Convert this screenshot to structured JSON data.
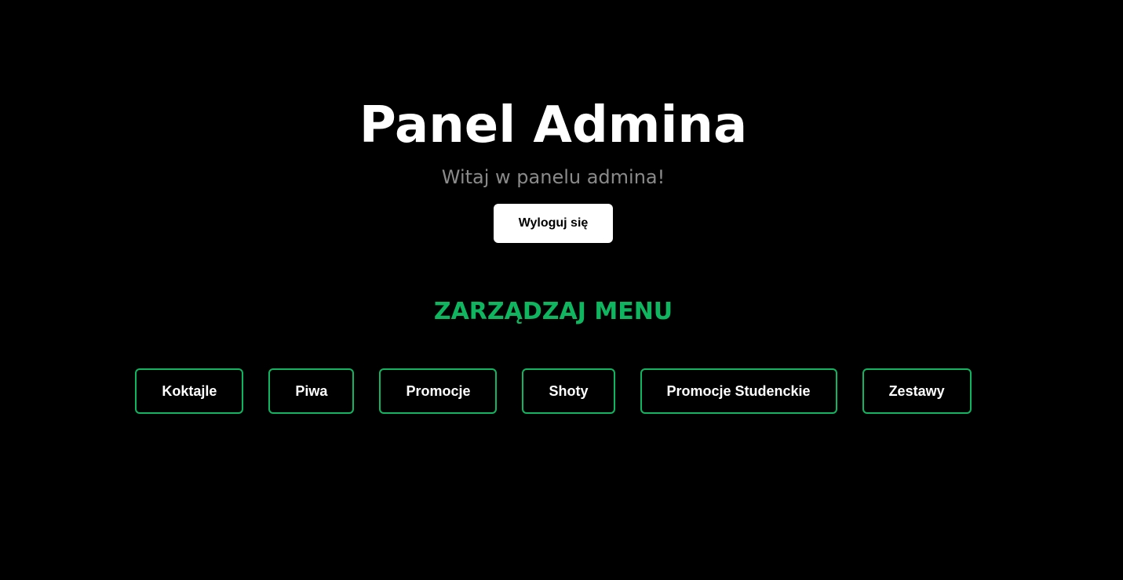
{
  "header": {
    "title": "Panel Admina",
    "subtitle": "Witaj w panelu admina!",
    "logout_label": "Wyloguj się"
  },
  "menu_section": {
    "title": "ZARZĄDZAJ MENU",
    "items": [
      {
        "label": "Koktajle"
      },
      {
        "label": "Piwa"
      },
      {
        "label": "Promocje"
      },
      {
        "label": "Shoty"
      },
      {
        "label": "Promocje Studenckie"
      },
      {
        "label": "Zestawy"
      }
    ]
  },
  "colors": {
    "background": "#000000",
    "accent": "#0fb660",
    "subtitle": "#8a8a8a",
    "text": "#ffffff"
  }
}
